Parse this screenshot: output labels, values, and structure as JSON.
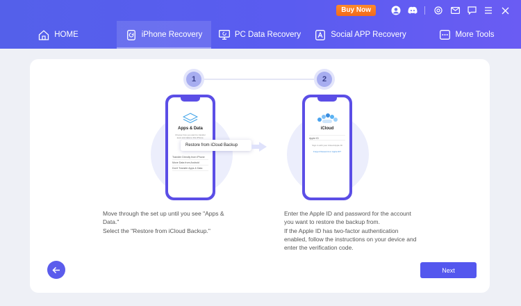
{
  "topbar": {
    "buy_now": "Buy Now",
    "icons": [
      "user-icon",
      "discord-icon",
      "settings-icon",
      "mail-icon",
      "chat-icon",
      "menu-icon",
      "close-icon"
    ],
    "buy_color": "#f26a1b"
  },
  "nav": {
    "tabs": [
      {
        "label": "HOME",
        "icon": "home-icon",
        "active": false
      },
      {
        "label": "iPhone Recovery",
        "icon": "iphone-recovery-icon",
        "active": true
      },
      {
        "label": "PC Data Recovery",
        "icon": "pc-data-recovery-icon",
        "active": false
      },
      {
        "label": "Social APP Recovery",
        "icon": "social-app-icon",
        "active": false
      },
      {
        "label": "More Tools",
        "icon": "more-tools-icon",
        "active": false
      }
    ],
    "accent": "#5a5cf0"
  },
  "steps": {
    "one": "1",
    "two": "2"
  },
  "phone1": {
    "title": "Apps & Data",
    "subtitle": "Choose how you want to transfer apps and data to this iPhone.",
    "popup": "Restore from iCloud Backup",
    "options": [
      "Transfer Directly from iPhone",
      "Move Data from Android",
      "Don't Transfer Apps & Data"
    ]
  },
  "phone2": {
    "title": "iCloud",
    "field": "Apple ID",
    "sign_in": "Sign in with your iCloud Apple ID",
    "forgot": "Forgot Password or Apple ID?"
  },
  "instructions": {
    "left": [
      "Move through the set up until you see \"Apps &",
      "Data.\"",
      "Select the \"Restore from iCloud Backup.\""
    ],
    "right": [
      "Enter the Apple ID and password for the account",
      "you want to restore the backup from.",
      "If the Apple ID has two-factor authentication",
      "enabled, follow the instructions on your device and",
      "enter the verification code."
    ]
  },
  "actions": {
    "next": "Next",
    "back_icon": "back-arrow-icon"
  }
}
